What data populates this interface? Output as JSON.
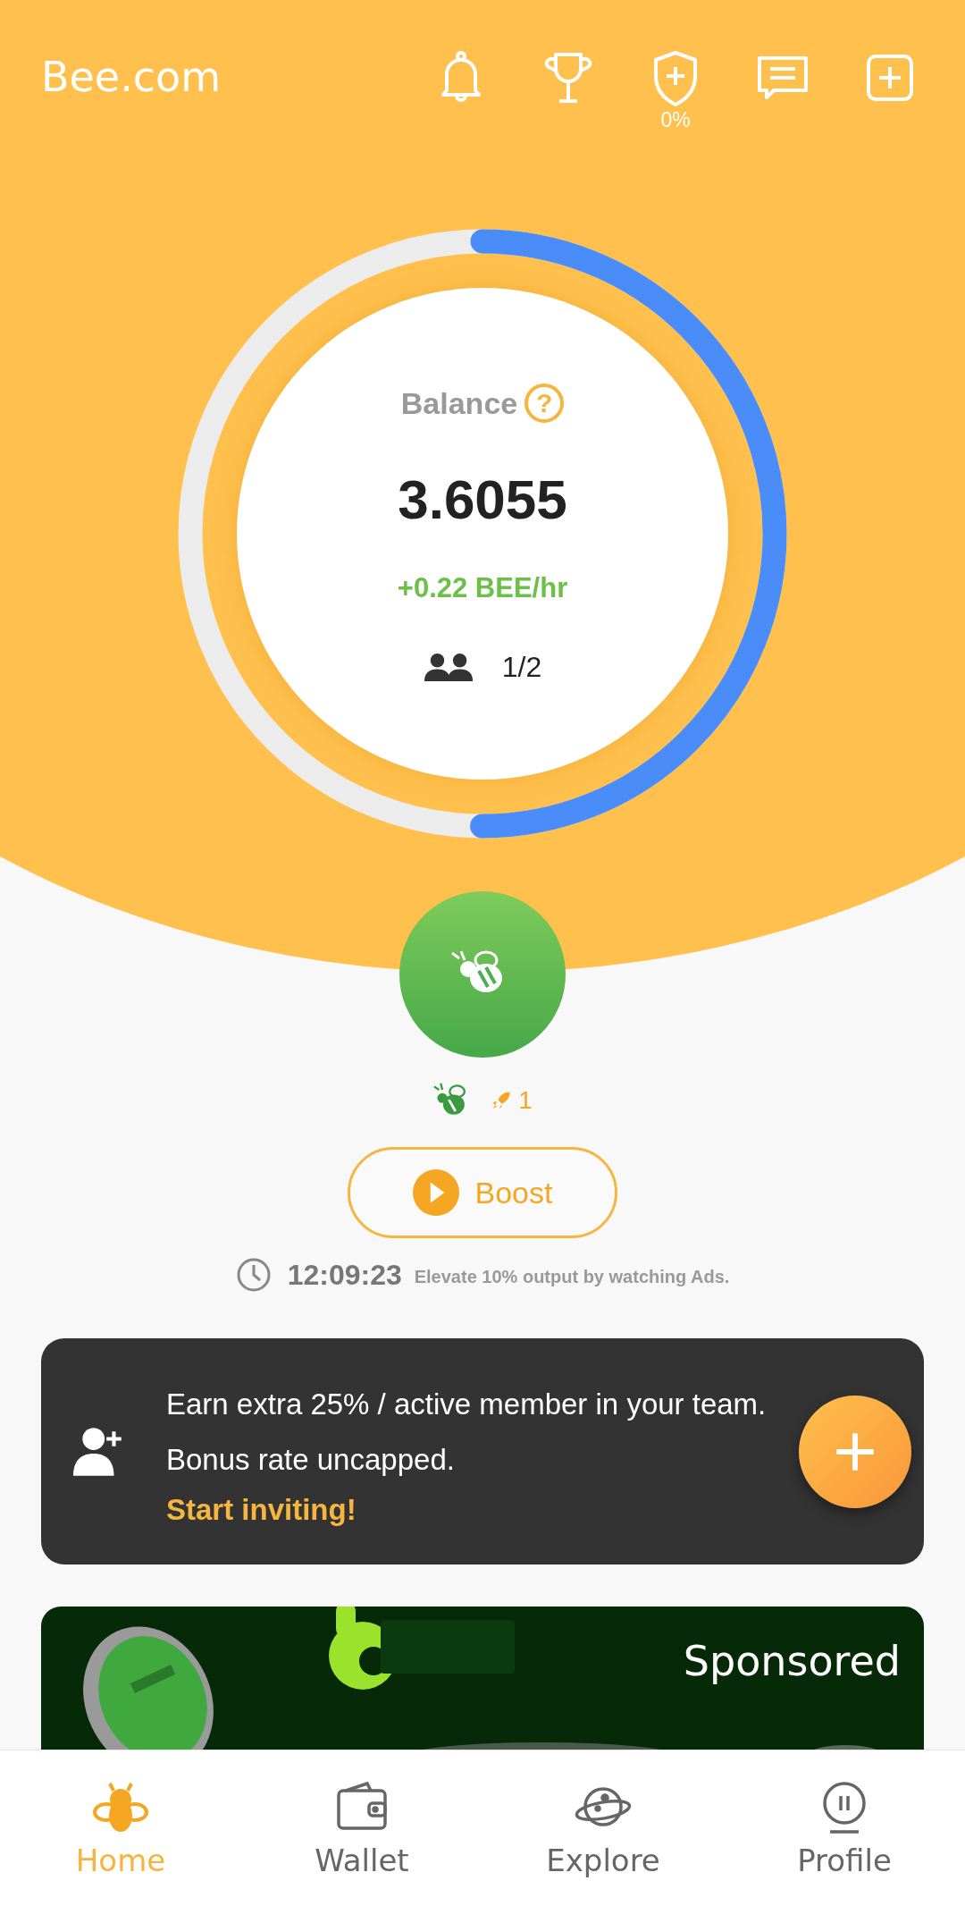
{
  "header": {
    "logo": "Bee.com",
    "shield_label": "0%"
  },
  "balance": {
    "label": "Balance",
    "help": "?",
    "amount": "3.6055",
    "rate": "+0.22 BEE/hr",
    "team": "1/2",
    "level": 0.5
  },
  "mining": {
    "boost_count": "1"
  },
  "boost": {
    "label": "Boost",
    "timer": "12:09:23",
    "hint": "Elevate 10% output by watching Ads."
  },
  "invite": {
    "text": "Earn extra 25% / active member in your team. Bonus rate uncapped.",
    "link": "Start inviting!"
  },
  "ad": {
    "kind": "picture",
    "label": "Sponsored"
  },
  "nav": [
    {
      "label": "Home",
      "kind": "bee",
      "selected": true
    },
    {
      "label": "Wallet",
      "kind": "wallet",
      "selected": false
    },
    {
      "label": "Explore",
      "kind": "planet",
      "selected": false
    },
    {
      "label": "Profile",
      "kind": "profile",
      "selected": false
    }
  ]
}
